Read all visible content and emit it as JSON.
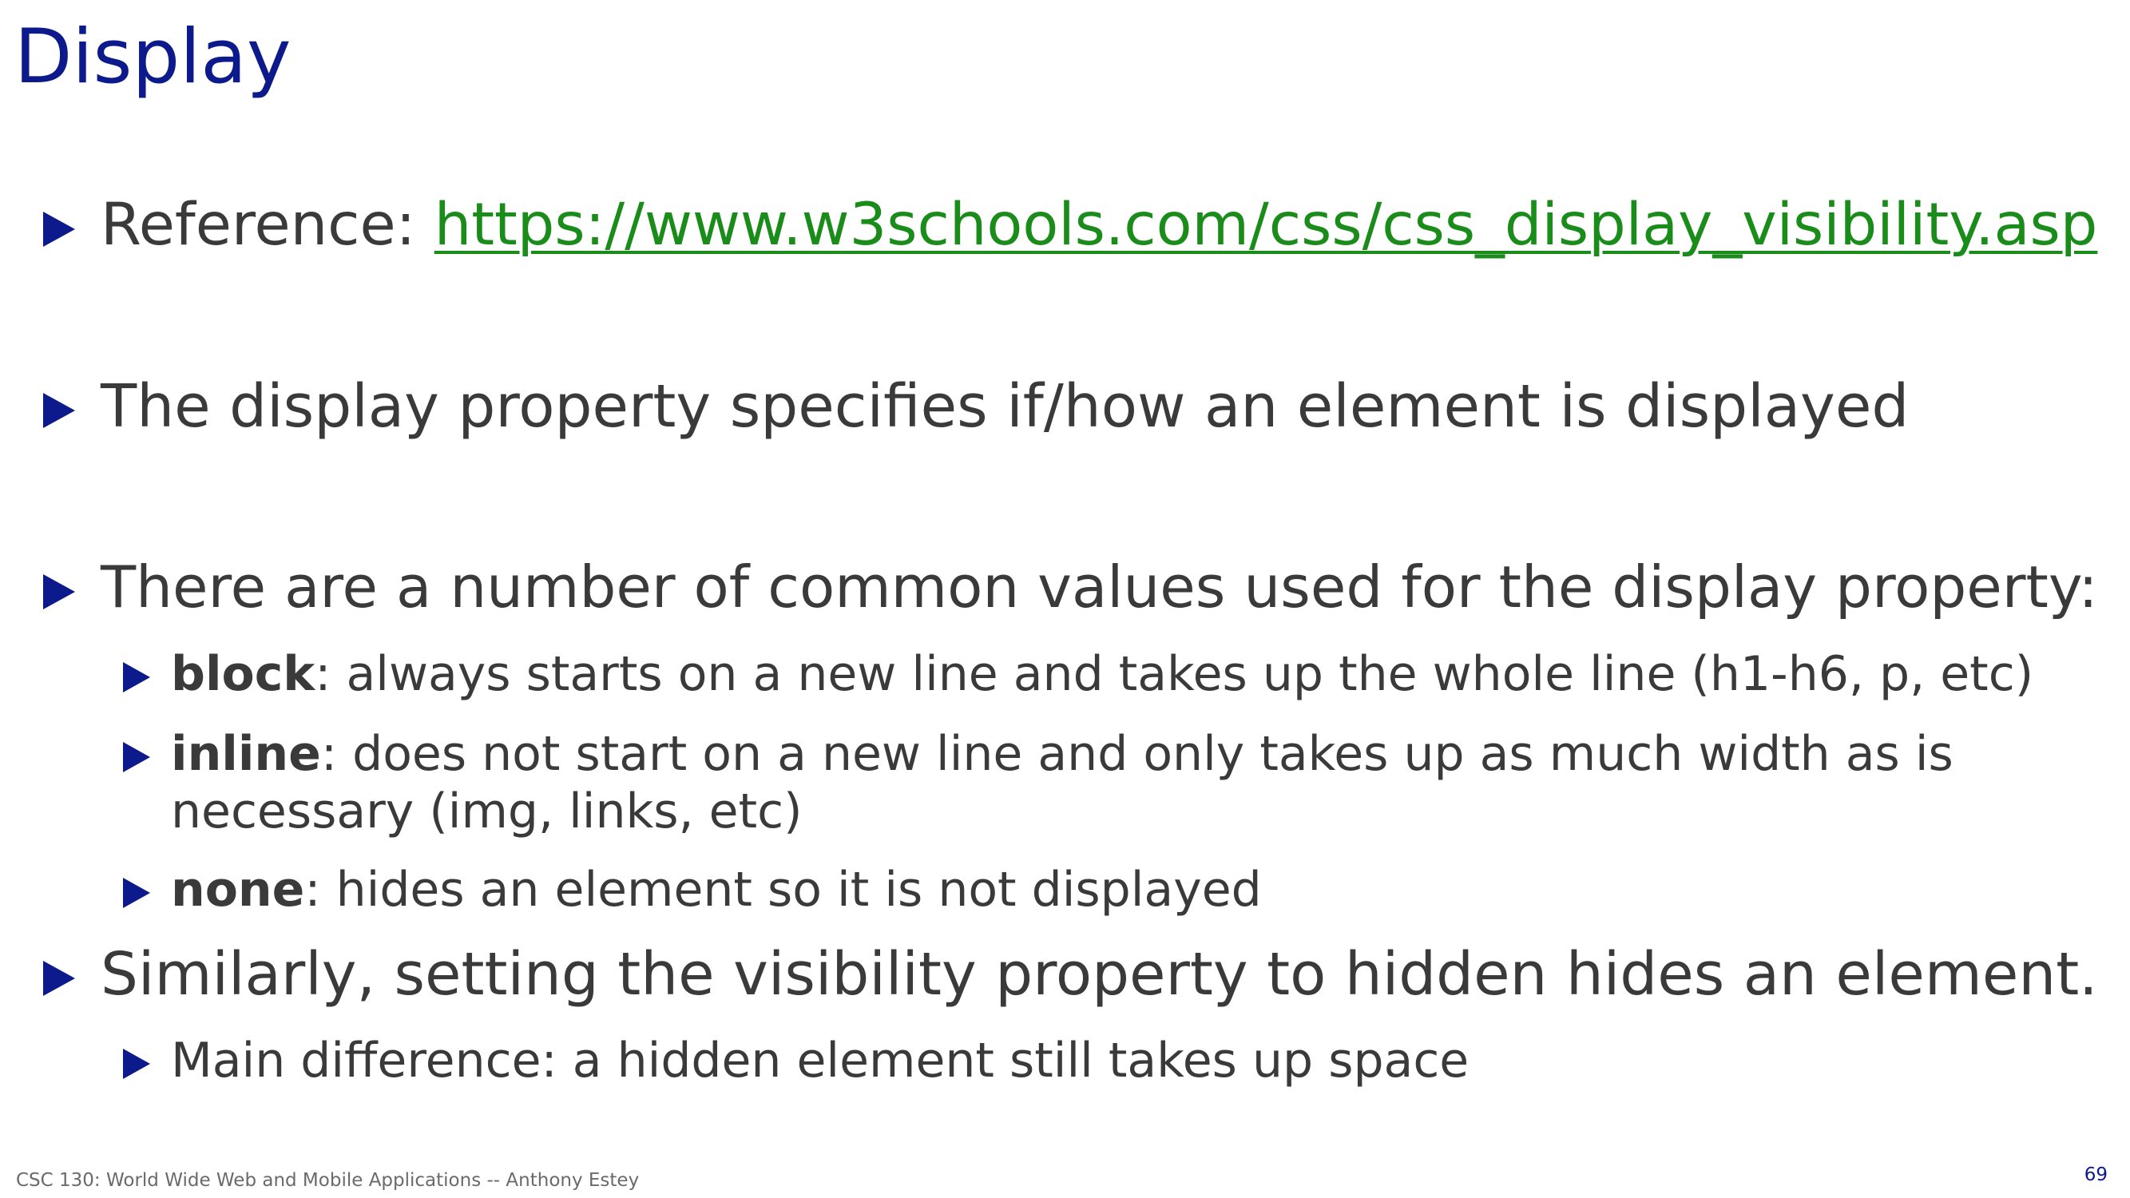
{
  "slide": {
    "title": "Display",
    "footer": "CSC 130: World Wide Web and Mobile Applications -- Anthony Estey",
    "page_number": "69"
  },
  "bullets": {
    "reference": {
      "label": "Reference: ",
      "link": "https://www.w3schools.com/css/css_display_visibility.asp"
    },
    "display_property": "The display property specifies if/how an element is displayed",
    "common_values": "There are a number of common values used for the display property:",
    "block": {
      "term": "block",
      "text": ": always starts on a new line and takes up the whole line (h1-h6, p, etc)"
    },
    "inline": {
      "term": "inline",
      "text_line1": ": does not start on a new line and only takes up as much width as is",
      "text_line2": "necessary (img, links, etc)"
    },
    "none": {
      "term": "none",
      "text": ": hides an element so it is not displayed"
    },
    "visibility": "Similarly, setting the visibility property to hidden hides an element.",
    "difference": "Main difference: a hidden element still takes up space"
  },
  "colors": {
    "title": "#0d1a8c",
    "bullet_marker": "#0d1a8c",
    "body_text": "#3a3a3a",
    "link": "#1a8c1a",
    "footer": "#6a6a6a"
  }
}
